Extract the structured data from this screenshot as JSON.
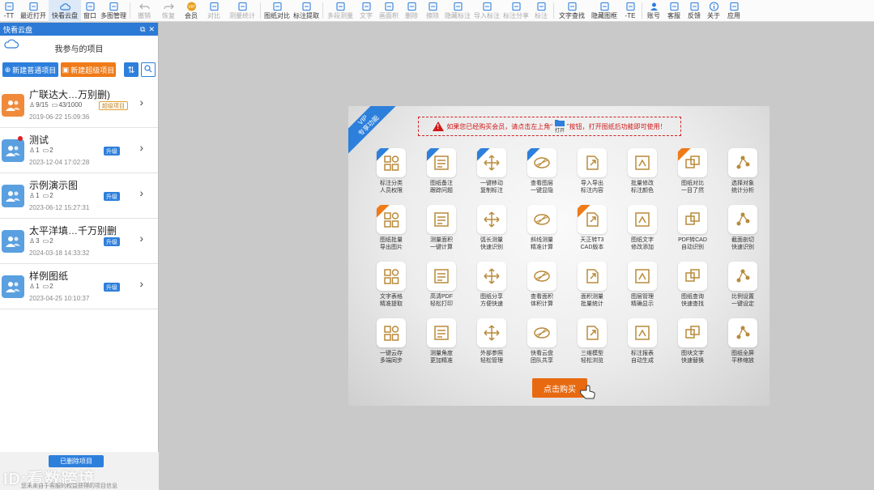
{
  "toolbar": {
    "items": [
      {
        "label": "-TT",
        "icon": "app-menu-icon",
        "disabled": false,
        "active": false
      },
      {
        "label": "最近打开",
        "icon": "history-icon",
        "disabled": false,
        "active": false
      },
      {
        "label": "快看云盘",
        "icon": "cloud-icon",
        "disabled": false,
        "active": true
      },
      {
        "label": "窗口",
        "icon": "window-icon",
        "disabled": false,
        "active": false
      },
      {
        "label": "多图管理",
        "icon": "layers-icon",
        "disabled": false,
        "active": false
      },
      {
        "label": "撤销",
        "icon": "undo-icon",
        "disabled": true,
        "active": false
      },
      {
        "label": "恢复",
        "icon": "redo-icon",
        "disabled": true,
        "active": false
      },
      {
        "label": "会员",
        "icon": "vip-icon",
        "disabled": false,
        "active": false
      },
      {
        "label": "对比",
        "icon": "compare-icon",
        "disabled": true,
        "active": false
      },
      {
        "label": "测量统计",
        "icon": "measure-icon",
        "disabled": true,
        "active": false
      },
      {
        "label": "图纸对比",
        "icon": "diff-icon",
        "disabled": false,
        "active": false
      },
      {
        "label": "标注提取",
        "icon": "extract-icon",
        "disabled": false,
        "active": false
      },
      {
        "label": "多段测量",
        "icon": "polyline-icon",
        "disabled": true,
        "active": false
      },
      {
        "label": "文字",
        "icon": "text-icon",
        "disabled": true,
        "active": false
      },
      {
        "label": "画面积",
        "icon": "area-icon",
        "disabled": true,
        "active": false
      },
      {
        "label": "删除",
        "icon": "delete-icon",
        "disabled": true,
        "active": false
      },
      {
        "label": "擦除",
        "icon": "eraser-icon",
        "disabled": true,
        "active": false
      },
      {
        "label": "隐藏标注",
        "icon": "hide-icon",
        "disabled": true,
        "active": false
      },
      {
        "label": "导入标注",
        "icon": "import-icon",
        "disabled": true,
        "active": false
      },
      {
        "label": "标注分享",
        "icon": "share-icon",
        "disabled": true,
        "active": false
      },
      {
        "label": "标注",
        "icon": "mark-icon",
        "disabled": true,
        "active": false
      },
      {
        "label": "文字查找",
        "icon": "find-text-icon",
        "disabled": false,
        "active": false
      },
      {
        "label": "隐藏图框",
        "icon": "frame-icon",
        "disabled": false,
        "active": false
      },
      {
        "label": "-TE",
        "icon": "export-icon",
        "disabled": false,
        "active": false
      },
      {
        "label": "账号",
        "icon": "user-icon",
        "disabled": false,
        "active": false
      },
      {
        "label": "客服",
        "icon": "headset-icon",
        "disabled": false,
        "active": false
      },
      {
        "label": "反馈",
        "icon": "feedback-icon",
        "disabled": false,
        "active": false
      },
      {
        "label": "关于",
        "icon": "info-icon",
        "disabled": false,
        "active": false
      },
      {
        "label": "应用",
        "icon": "cube-icon",
        "disabled": false,
        "active": false
      }
    ]
  },
  "sidebar": {
    "header_title": "快看云盘",
    "header_ctrls": [
      "⧉",
      "✕"
    ],
    "title": "我参与的项目",
    "new_project_label": "新建普通项目",
    "new_vip_project_label": "新建超级项目",
    "projects": [
      {
        "name": "广联达大…万别删)",
        "members": "9/15",
        "files": "43/1000",
        "badge": "超级项目",
        "badge_style": "outline",
        "date": "2019-06-22 15:09:36",
        "avatar_color": "orange",
        "unread": false
      },
      {
        "name": "测试",
        "members": "1",
        "files": "2",
        "badge": "升级",
        "badge_style": "solid",
        "date": "2023-12-04 17:02:28",
        "avatar_color": "blue",
        "unread": true
      },
      {
        "name": "示例演示图",
        "members": "1",
        "files": "2",
        "badge": "升级",
        "badge_style": "solid",
        "date": "2023-06-12 15:27:31",
        "avatar_color": "blue",
        "unread": false
      },
      {
        "name": "太平洋填…千万别删",
        "members": "3",
        "files": "2",
        "badge": "升级",
        "badge_style": "solid",
        "date": "2024-03-18 14:33:32",
        "avatar_color": "blue",
        "unread": false
      },
      {
        "name": "样例图纸",
        "members": "1",
        "files": "2",
        "badge": "升级",
        "badge_style": "solid",
        "date": "2023-04-25 10:10:37",
        "avatar_color": "blue",
        "unread": false
      }
    ],
    "shared_button": "已删除项目",
    "watermark": "ID:看数跨境",
    "hint": "您未来自于客服的权益获得的项目信息"
  },
  "vip": {
    "ribbon_line1": "VIP",
    "ribbon_line2": "专享功能",
    "notice_text": "如果您已经购买会员，请点击左上角“",
    "notice_open": "打开",
    "notice_text2": "”按钮，打开图纸后功能即可使用！",
    "buy_label": "点击购买",
    "features": [
      {
        "label": "标注分类\n人员权限",
        "corner": "blue",
        "icon": "category-icon"
      },
      {
        "label": "图纸备注\n跟踪问题",
        "corner": "blue",
        "icon": "note-icon"
      },
      {
        "label": "一键移动\n复制标注",
        "corner": "blue",
        "icon": "move-icon"
      },
      {
        "label": "查看图层\n一键显隐",
        "corner": "blue",
        "icon": "layer-icon"
      },
      {
        "label": "导入导出\n标注内容",
        "corner": "",
        "icon": "import-export-icon"
      },
      {
        "label": "批量修改\n标注颜色",
        "corner": "",
        "icon": "recolor-icon"
      },
      {
        "label": "图纸对比\n一目了然",
        "corner": "orange",
        "icon": "compare-icon"
      },
      {
        "label": "选择对象\n统计分析",
        "corner": "",
        "icon": "select-icon"
      },
      {
        "label": "图纸批量\n导出图片",
        "corner": "orange",
        "icon": "image-export-icon"
      },
      {
        "label": "测量面积\n一键计算",
        "corner": "",
        "icon": "area-measure-icon"
      },
      {
        "label": "弧长测量\n快速识别",
        "corner": "",
        "icon": "arc-icon"
      },
      {
        "label": "斜线测量\n精准计算",
        "corner": "",
        "icon": "line-icon"
      },
      {
        "label": "天正转T3\nCAD版本",
        "corner": "orange",
        "icon": "convert-icon"
      },
      {
        "label": "图纸文字\n修改添加",
        "corner": "",
        "icon": "edit-text-icon"
      },
      {
        "label": "PDF转CAD\n自动识别",
        "corner": "",
        "icon": "pdf-icon"
      },
      {
        "label": "截面剖切\n快速识别",
        "corner": "",
        "icon": "section-icon"
      },
      {
        "label": "文字表格\n精准提取",
        "corner": "",
        "icon": "table-icon"
      },
      {
        "label": "高清PDF\n轻松打印",
        "corner": "",
        "icon": "print-icon"
      },
      {
        "label": "图纸分享\n方便快速",
        "corner": "",
        "icon": "share-icon"
      },
      {
        "label": "查看面积\n体积计算",
        "corner": "",
        "icon": "volume-icon"
      },
      {
        "label": "面积测量\n批量统计",
        "corner": "",
        "icon": "area-stat-icon"
      },
      {
        "label": "图层管理\n精确显示",
        "corner": "",
        "icon": "layers-icon"
      },
      {
        "label": "图纸查询\n快速查找",
        "corner": "",
        "icon": "search-icon"
      },
      {
        "label": "比例设置\n一键设定",
        "corner": "",
        "icon": "scale-icon"
      },
      {
        "label": "一键云存\n多端同步",
        "corner": "",
        "icon": "cloud-sync-icon"
      },
      {
        "label": "测量角度\n更加精准",
        "corner": "",
        "icon": "angle-icon"
      },
      {
        "label": "外部参照\n轻松管理",
        "corner": "",
        "icon": "xref-icon"
      },
      {
        "label": "快看云盘\n团队共享",
        "corner": "",
        "icon": "cloud-team-icon"
      },
      {
        "label": "三维模型\n轻松浏览",
        "corner": "",
        "icon": "model-3d-icon"
      },
      {
        "label": "标注报表\n自动生成",
        "corner": "",
        "icon": "report-icon"
      },
      {
        "label": "图块文字\n快速替换",
        "corner": "",
        "icon": "replace-icon"
      },
      {
        "label": "图纸全屏\n平移缩放",
        "corner": "",
        "icon": "pan-icon"
      }
    ]
  },
  "colors": {
    "accent_blue": "#2d7fdc",
    "accent_orange": "#ef7a17",
    "icon_gold": "#b98a3a",
    "notice_red": "#d01818"
  }
}
